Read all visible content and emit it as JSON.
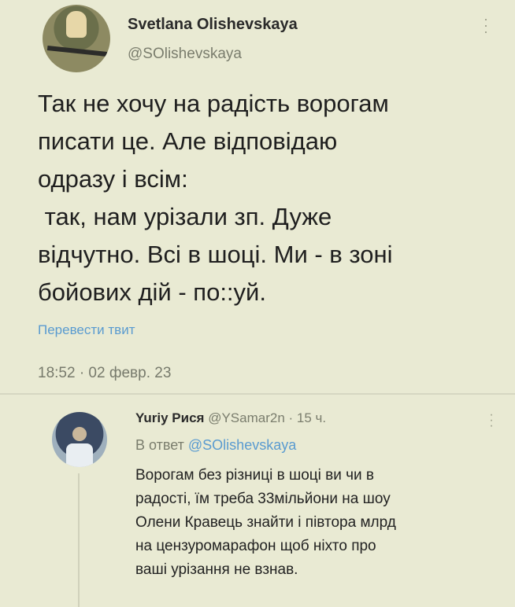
{
  "tweet": {
    "author_name": "Svetlana Olishevskaya",
    "author_handle": "@SOlishevskaya",
    "text": "Так не хочу на радість ворогам\nписати це. Але відповідаю\nодразу і всім:\n так, нам урізали зп. Дуже\nвідчутно. Всі в шоці. Ми - в зоні\nбойових дій - по::уй.",
    "translate_label": "Перевести твит",
    "timestamp": "18:52 · 02 февр. 23",
    "menu_icon": "more-vertical-icon"
  },
  "reply": {
    "author_name": "Yuriy Рися",
    "author_handle": "@YSamar2n",
    "age": "· 15 ч.",
    "reply_to_prefix": "В ответ",
    "reply_to_handle": "@SOlishevskaya",
    "text": "Ворогам без різниці в шоці ви чи в\nрадості, їм треба 33мільйони на шоу\nОлени Кравець знайти і півтора млрд\nна цензуромарафон щоб ніхто про\nваші урізання не взнав.",
    "menu_icon": "more-vertical-icon"
  },
  "colors": {
    "background": "#e9ead3",
    "link": "#5a9bd0",
    "secondary_text": "#7a7d6d"
  }
}
